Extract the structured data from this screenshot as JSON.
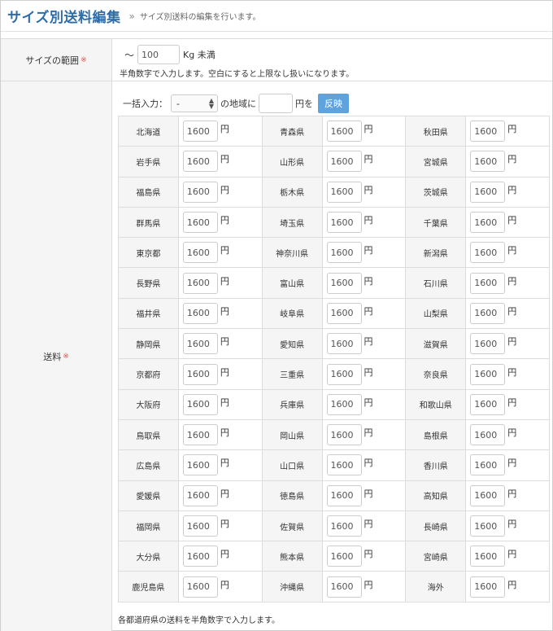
{
  "header": {
    "title": "サイズ別送料編集",
    "separator": "»",
    "subtitle": "サイズ別送料の編集を行います。"
  },
  "size_range": {
    "label": "サイズの範囲",
    "required_mark": "※",
    "tilde": "〜",
    "value": "100",
    "unit": "Kg 未満",
    "note": "半角数字で入力します。空白にすると上限なし扱いになります。"
  },
  "shipping": {
    "label": "送料",
    "required_mark": "※",
    "bulk": {
      "label": "一括入力：",
      "select_value": "-",
      "text_region": "の地域に",
      "input_value": "",
      "text_yen": "円を",
      "button_label": "反映"
    },
    "prefectures": [
      {
        "name": "北海道",
        "fee": "1600"
      },
      {
        "name": "青森県",
        "fee": "1600"
      },
      {
        "name": "秋田県",
        "fee": "1600"
      },
      {
        "name": "岩手県",
        "fee": "1600"
      },
      {
        "name": "山形県",
        "fee": "1600"
      },
      {
        "name": "宮城県",
        "fee": "1600"
      },
      {
        "name": "福島県",
        "fee": "1600"
      },
      {
        "name": "栃木県",
        "fee": "1600"
      },
      {
        "name": "茨城県",
        "fee": "1600"
      },
      {
        "name": "群馬県",
        "fee": "1600"
      },
      {
        "name": "埼玉県",
        "fee": "1600"
      },
      {
        "name": "千葉県",
        "fee": "1600"
      },
      {
        "name": "東京都",
        "fee": "1600"
      },
      {
        "name": "神奈川県",
        "fee": "1600"
      },
      {
        "name": "新潟県",
        "fee": "1600"
      },
      {
        "name": "長野県",
        "fee": "1600"
      },
      {
        "name": "富山県",
        "fee": "1600"
      },
      {
        "name": "石川県",
        "fee": "1600"
      },
      {
        "name": "福井県",
        "fee": "1600"
      },
      {
        "name": "岐阜県",
        "fee": "1600"
      },
      {
        "name": "山梨県",
        "fee": "1600"
      },
      {
        "name": "静岡県",
        "fee": "1600"
      },
      {
        "name": "愛知県",
        "fee": "1600"
      },
      {
        "name": "滋賀県",
        "fee": "1600"
      },
      {
        "name": "京都府",
        "fee": "1600"
      },
      {
        "name": "三重県",
        "fee": "1600"
      },
      {
        "name": "奈良県",
        "fee": "1600"
      },
      {
        "name": "大阪府",
        "fee": "1600"
      },
      {
        "name": "兵庫県",
        "fee": "1600"
      },
      {
        "name": "和歌山県",
        "fee": "1600"
      },
      {
        "name": "鳥取県",
        "fee": "1600"
      },
      {
        "name": "岡山県",
        "fee": "1600"
      },
      {
        "name": "島根県",
        "fee": "1600"
      },
      {
        "name": "広島県",
        "fee": "1600"
      },
      {
        "name": "山口県",
        "fee": "1600"
      },
      {
        "name": "香川県",
        "fee": "1600"
      },
      {
        "name": "愛媛県",
        "fee": "1600"
      },
      {
        "name": "徳島県",
        "fee": "1600"
      },
      {
        "name": "高知県",
        "fee": "1600"
      },
      {
        "name": "福岡県",
        "fee": "1600"
      },
      {
        "name": "佐賀県",
        "fee": "1600"
      },
      {
        "name": "長崎県",
        "fee": "1600"
      },
      {
        "name": "大分県",
        "fee": "1600"
      },
      {
        "name": "熊本県",
        "fee": "1600"
      },
      {
        "name": "宮崎県",
        "fee": "1600"
      },
      {
        "name": "鹿児島県",
        "fee": "1600"
      },
      {
        "name": "沖縄県",
        "fee": "1600"
      },
      {
        "name": "海外",
        "fee": "1600"
      }
    ],
    "yen": "円",
    "note": "各都道府県の送料を半角数字で入力します。"
  },
  "colors": {
    "title": "#2f6da8",
    "required": "#d9534f",
    "button": "#5fa3de"
  }
}
